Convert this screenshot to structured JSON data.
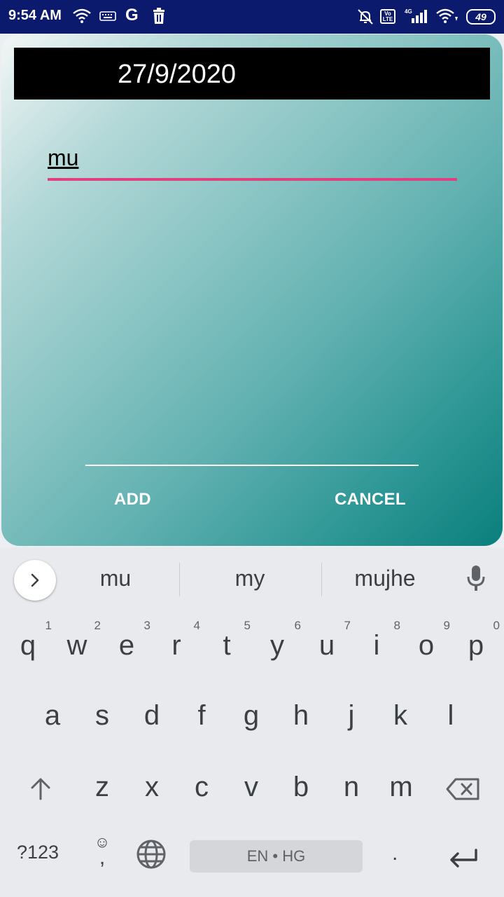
{
  "status_bar": {
    "time": "9:54 AM",
    "google_glyph": "G",
    "volte": "Vo LTE",
    "network": "4G",
    "battery": "49"
  },
  "dialog": {
    "date": "27/9/2020",
    "input_value": "mu",
    "add_label": "ADD",
    "cancel_label": "CANCEL",
    "colors": {
      "gradient_start": "#f3f6f6",
      "gradient_end": "#0a7f7c",
      "input_underline": "#e0407d",
      "date_bar": "#000000"
    }
  },
  "keyboard": {
    "suggestions": [
      "mu",
      "my",
      "mujhe"
    ],
    "row1": [
      {
        "key": "q",
        "hint": "1"
      },
      {
        "key": "w",
        "hint": "2"
      },
      {
        "key": "e",
        "hint": "3"
      },
      {
        "key": "r",
        "hint": "4"
      },
      {
        "key": "t",
        "hint": "5"
      },
      {
        "key": "y",
        "hint": "6"
      },
      {
        "key": "u",
        "hint": "7"
      },
      {
        "key": "i",
        "hint": "8"
      },
      {
        "key": "o",
        "hint": "9"
      },
      {
        "key": "p",
        "hint": "0"
      }
    ],
    "row2": [
      "a",
      "s",
      "d",
      "f",
      "g",
      "h",
      "j",
      "k",
      "l"
    ],
    "row3": [
      "z",
      "x",
      "c",
      "v",
      "b",
      "n",
      "m"
    ],
    "symbols_label": "?123",
    "comma": ",",
    "emoji_glyph": "☺",
    "space_label": "EN • HG",
    "period": "."
  }
}
